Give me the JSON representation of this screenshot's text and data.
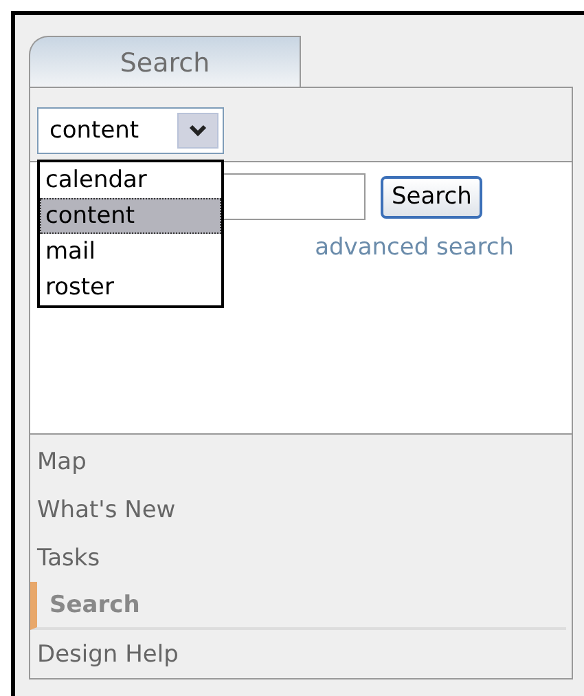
{
  "tab": {
    "label": "Search"
  },
  "scope_select": {
    "value": "content",
    "expanded": true,
    "options": [
      {
        "label": "calendar",
        "selected": false
      },
      {
        "label": "content",
        "selected": true
      },
      {
        "label": "mail",
        "selected": false
      },
      {
        "label": "roster",
        "selected": false
      }
    ]
  },
  "search_button": "Search",
  "advanced_link": "advanced search",
  "nav": [
    {
      "label": "Map",
      "selected": false
    },
    {
      "label": "What's New",
      "selected": false
    },
    {
      "label": "Tasks",
      "selected": false
    },
    {
      "label": "Search",
      "selected": true
    },
    {
      "label": "Design Help",
      "selected": false
    }
  ]
}
